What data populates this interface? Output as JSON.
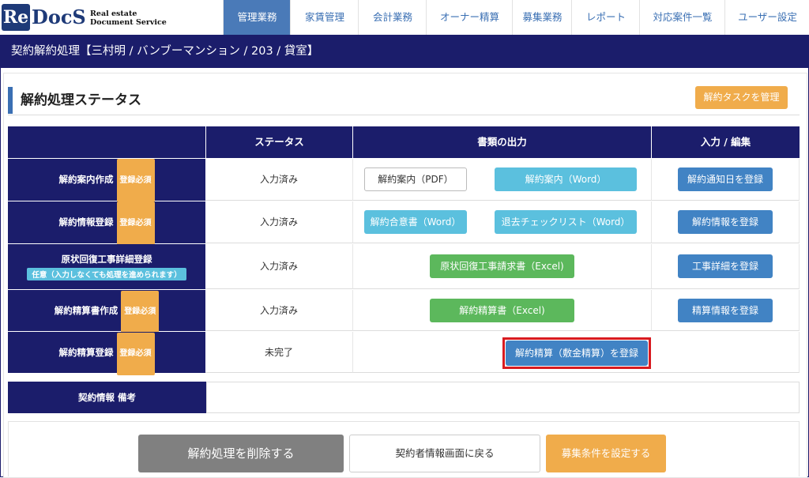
{
  "logo": {
    "re": "Re",
    "docs": "DocS",
    "line1": "Real estate",
    "line2": "Document Service"
  },
  "nav": [
    "管理業務",
    "家賃管理",
    "会計業務",
    "オーナー精算",
    "募集業務",
    "レポート",
    "対応案件一覧",
    "ユーザー設定"
  ],
  "page_title": "契約解約処理【三村明 / バンブーマンション / 203 / 貸室】",
  "section": {
    "title": "解約処理ステータス",
    "manage_tasks_button": "解約タスクを管理"
  },
  "table": {
    "headers": {
      "blank": "",
      "status": "ステータス",
      "docs": "書類の出力",
      "edit": "入力 / 編集"
    },
    "rows": [
      {
        "label": "解約案内作成",
        "badge": "登録必須",
        "status": "入力済み",
        "doc1": "解約案内（PDF）",
        "doc2": "解約案内（Word）",
        "action": "解約通知日を登録"
      },
      {
        "label": "解約情報登録",
        "badge": "登録必須",
        "status": "入力済み",
        "doc1": "解約合意書（Word）",
        "doc2": "退去チェックリスト（Word）",
        "action": "解約情報を登録"
      },
      {
        "label": "原状回復工事詳細登録",
        "badge": "任意（入力しなくても処理を進められます）",
        "status": "入力済み",
        "doc1": "原状回復工事請求書（Excel)",
        "action": "工事詳細を登録"
      },
      {
        "label": "解約精算書作成",
        "badge": "登録必須",
        "status": "入力済み",
        "doc1": "解約精算書（Excel)",
        "action": "精算情報を登録"
      },
      {
        "label": "解約精算登録",
        "badge": "登録必須",
        "status": "未完了",
        "doc1": "解約精算（敷金精算）を登録"
      }
    ]
  },
  "remarks": {
    "label": "契約情報 備考",
    "value": ""
  },
  "footer": {
    "delete_button": "解約処理を削除する",
    "back_button": "契約者情報画面に戻る",
    "recruit_button": "募集条件を設定する"
  }
}
